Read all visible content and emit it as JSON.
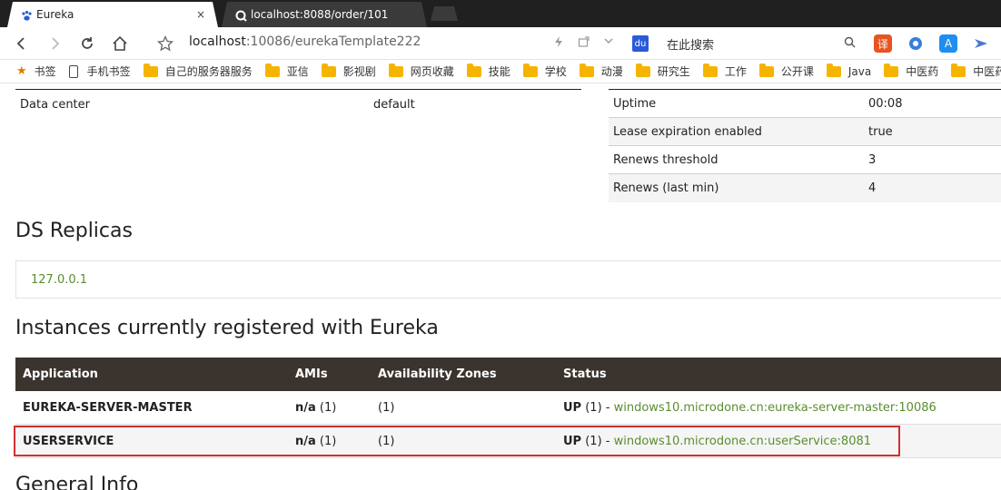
{
  "browser": {
    "tabs": [
      {
        "label": "Eureka",
        "active": true
      },
      {
        "label": "localhost:8088/order/101",
        "active": false
      }
    ],
    "close_glyph": "×",
    "url_host": "localhost",
    "url_path": ":10086/eurekaTemplate222",
    "search_placeholder": "在此搜索",
    "search_engine_glyph": "du",
    "ext_translate": "译",
    "ext_a": "A",
    "bookmarks": [
      {
        "label": "书签",
        "icon": "star-icon"
      },
      {
        "label": "手机书签",
        "icon": "phone-icon"
      },
      {
        "label": "自己的服务器服务",
        "icon": "folder-icon"
      },
      {
        "label": "亚信",
        "icon": "folder-icon"
      },
      {
        "label": "影视剧",
        "icon": "folder-icon"
      },
      {
        "label": "网页收藏",
        "icon": "folder-icon"
      },
      {
        "label": "技能",
        "icon": "folder-icon"
      },
      {
        "label": "学校",
        "icon": "folder-icon"
      },
      {
        "label": "动漫",
        "icon": "folder-icon"
      },
      {
        "label": "研究生",
        "icon": "folder-icon"
      },
      {
        "label": "工作",
        "icon": "folder-icon"
      },
      {
        "label": "公开课",
        "icon": "folder-icon"
      },
      {
        "label": "Java",
        "icon": "folder-icon"
      },
      {
        "label": "中医药",
        "icon": "folder-icon"
      },
      {
        "label": "中医药学",
        "icon": "folder-icon"
      }
    ]
  },
  "system_status": {
    "left": [
      {
        "key": "Data center",
        "value": "default"
      }
    ],
    "right": [
      {
        "key": "Uptime",
        "value": "00:08"
      },
      {
        "key": "Lease expiration enabled",
        "value": "true"
      },
      {
        "key": "Renews threshold",
        "value": "3"
      },
      {
        "key": "Renews (last min)",
        "value": "4"
      }
    ]
  },
  "ds_replicas": {
    "title": "DS Replicas",
    "items": [
      "127.0.0.1"
    ]
  },
  "instances": {
    "title": "Instances currently registered with Eureka",
    "headers": [
      "Application",
      "AMIs",
      "Availability Zones",
      "Status"
    ],
    "rows": [
      {
        "app": "EUREKA-SERVER-MASTER",
        "amis_bold": "n/a",
        "amis_count": " (1)",
        "zones": "(1)",
        "status_bold": "UP",
        "status_count": " (1) - ",
        "status_link": "windows10.microdone.cn:eureka-server-master:10086"
      },
      {
        "app": "USERSERVICE",
        "amis_bold": "n/a",
        "amis_count": " (1)",
        "zones": "(1)",
        "status_bold": "UP",
        "status_count": " (1) - ",
        "status_link": "windows10.microdone.cn:userService:8081"
      }
    ],
    "highlight_color": "#d32f2f"
  },
  "general_info": {
    "title": "General Info"
  },
  "colors": {
    "link": "#5a8d2e",
    "table_header": "#3b342e"
  }
}
